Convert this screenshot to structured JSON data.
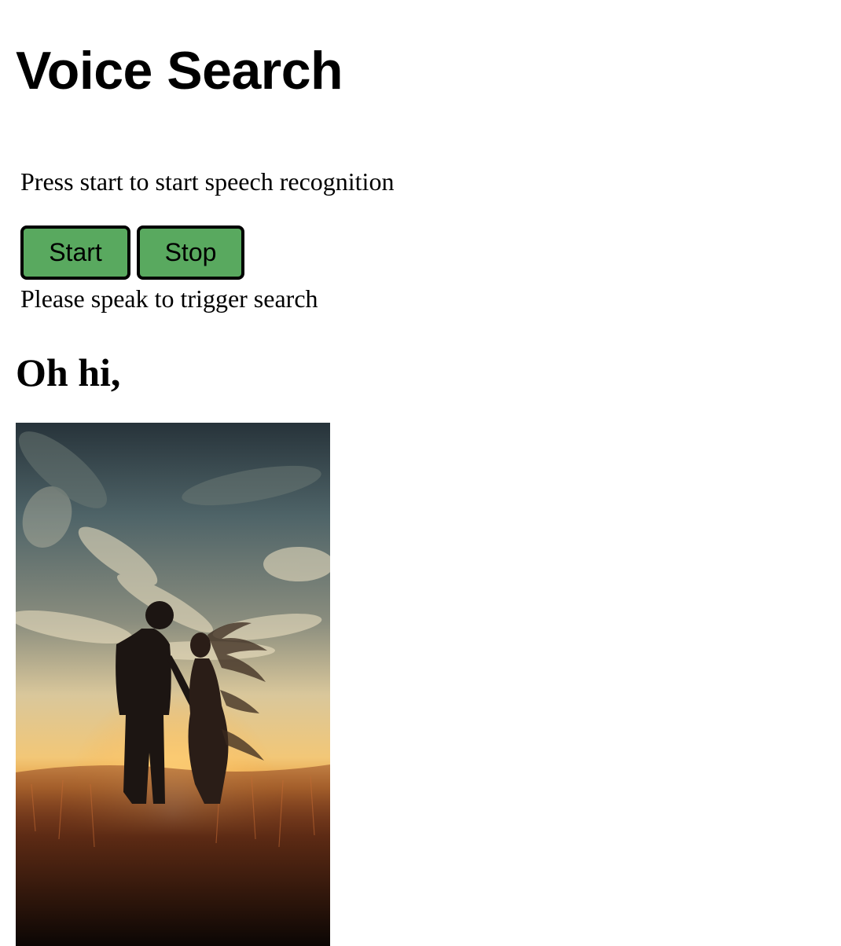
{
  "page": {
    "title": "Voice Search",
    "instructions": "Press start to start speech recognition",
    "status": "Please speak to trigger search",
    "greeting": "Oh hi,"
  },
  "controls": {
    "start_label": "Start",
    "stop_label": "Stop",
    "button_color": "#59a95f"
  },
  "result_image": {
    "description_icon": "couple-in-field-at-sunset-image"
  }
}
